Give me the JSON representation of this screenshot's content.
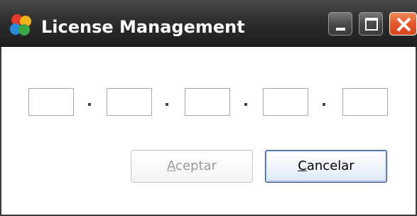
{
  "window": {
    "title": "License Management",
    "controls": {
      "minimize": "minimize",
      "maximize": "maximize",
      "close": "close"
    }
  },
  "license": {
    "segments": [
      "",
      "",
      "",
      "",
      ""
    ],
    "separator": "-"
  },
  "buttons": {
    "accept": {
      "label_first": "A",
      "label_rest": "ceptar",
      "enabled": false
    },
    "cancel": {
      "label_first": "C",
      "label_rest": "ancelar",
      "enabled": true
    }
  },
  "icons": {
    "app": "app-logo-icon",
    "minimize": "minimize-icon",
    "maximize": "maximize-icon",
    "close": "close-icon"
  },
  "colors": {
    "titlebar": "#2e2e2e",
    "close_button": "#e2592a",
    "focus_border": "#1e3a6e"
  }
}
